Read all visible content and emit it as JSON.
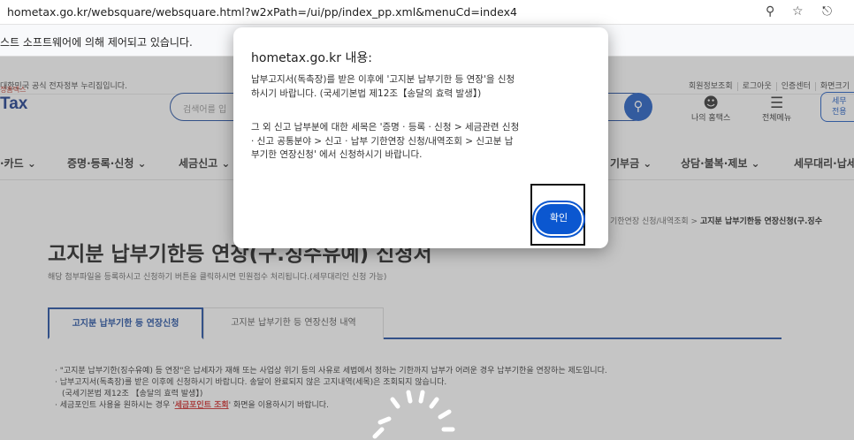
{
  "browser": {
    "url": "hometax.go.kr/websquare/websquare.html?w2xPath=/ui/pp/index_pp.xml&menuCd=index4",
    "zoom_icon": "zoom-icon",
    "star_icon": "star-icon",
    "extension_icon": "puzzle-icon"
  },
  "infobar": {
    "text": "스트 소프트웨어에 의해 제어되고 있습니다."
  },
  "site": {
    "gov_text": "대한민국 공식 전자정부 누리집입니다.",
    "top_links": [
      "회원정보조회",
      "로그아웃",
      "인증센터",
      "화면크기"
    ],
    "logo_small": "정홈택스",
    "logo": "Tax",
    "search_placeholder": "검색어를 입",
    "my_hometax": "나의 홈택스",
    "all_menu": "전체메뉴",
    "side_button_line1": "세무",
    "side_button_line2": "전용",
    "gnb": [
      "·카드 ⌄",
      "증명·등록·신청 ⌄",
      "세금신고 ⌄",
      "기부금 ⌄",
      "상담·불복·제보 ⌄",
      "세무대리·납세"
    ],
    "breadcrumb_prefix": "기한연장 신청/내역조회 >",
    "breadcrumb_current": "고지분 납부기한등 연장신청(구.징수"
  },
  "main": {
    "title": "고지분 납부기한등 연장(구.징수유예) 신청서",
    "subtitle": "해당 첨부파일을 등록하시고 신청하기 버튼을 클릭하시면 민원접수 처리됩니다.(세무대리인 신청 가능)",
    "tabs": [
      {
        "label": "고지분 납부기한 등 연장신청",
        "active": true
      },
      {
        "label": "고지분 납부기한 등 연장신청 내역",
        "active": false
      }
    ],
    "notes": {
      "line1": "· \"고지분 납부기한(징수유예) 등 연장\"은 납세자가 재해 또는 사업상 위기 등의 사유로 세법에서 정하는 기한까지 납부가 어려운 경우 납부기한을 연장하는 제도입니다.",
      "line2": "· 납부고지서(독촉장)를 받은 이후에 신청하시기 바랍니다. 송달이 완료되지 않은 고지내역(세목)은 조회되지 않습니다.",
      "line3": "(국세기본법 제12조 【송달의 효력 발생】)",
      "line4_pre": "· 세금포인트 사용을 원하시는 경우 '",
      "line4_link": "세금포인트 조회",
      "line4_post": "' 화면을 이용하시기 바랍니다."
    }
  },
  "dialog": {
    "title": "hometax.go.kr 내용:",
    "msg1_line1": "납부고지서(독촉장)를 받은 이후에 '고지분 납부기한 등 연장'을 신청",
    "msg1_line2": "하시기 바랍니다. (국세기본법 제12조【송달의 효력 발생】)",
    "msg2_line1": "그 외 신고 납부분에 대한 세목은 '증명 · 등록 · 신청 > 세금관련 신청",
    "msg2_line2": "· 신고 공통분야 > 신고 · 납부 기한연장 신청/내역조회 > 신고분 납",
    "msg2_line3": "부기한 연장신청' 에서 신청하시기 바랍니다.",
    "ok_label": "확인"
  },
  "colors": {
    "primary": "#1f4ea1",
    "button": "#0b57d0",
    "note_link": "#d32f2f"
  }
}
